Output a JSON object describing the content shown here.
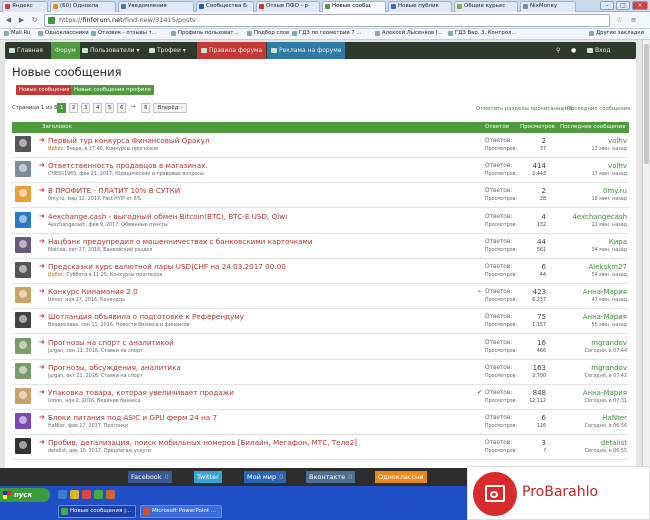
{
  "browser": {
    "tabs": [
      {
        "label": "Яндекс",
        "fav": "#d33"
      },
      {
        "label": "(60) Однокла",
        "fav": "#f08c1c"
      },
      {
        "label": "Уведомления",
        "fav": "#4a76a8"
      },
      {
        "label": "Сообщества Б",
        "fav": "#2a5ca8"
      },
      {
        "label": "Отзыв ПФО - р",
        "fav": "#c33"
      },
      {
        "label": "Новые сообщ",
        "fav": "#4f9a3f"
      },
      {
        "label": "Новые публик",
        "fav": "#3a6fb0"
      },
      {
        "label": "Общие курьес",
        "fav": "#8a4"
      },
      {
        "label": "NixMoney",
        "fav": "#888"
      }
    ],
    "url_scheme": "https://",
    "url_host": "finforum.net",
    "url_path": "/find-new/31415/posts",
    "bookmarks": [
      "Mail.Ru",
      "Одноклассники",
      "Отзовик - отзывы т...",
      "Профиль пользоват...",
      "Подбор слов",
      "ГДЗ по геометрии 7 ...",
      "Алексей Лысенков |...",
      "ГДЗ Вар. 3, Контрол..."
    ],
    "other_bookmarks": "Другие закладки"
  },
  "nav": {
    "items": [
      "Главная",
      "Форум",
      "Пользователи",
      "Трофеи",
      "Правила форума",
      "Реклама на форуме"
    ],
    "login": "Вход"
  },
  "page": {
    "title": "Новые сообщения",
    "tab_new": "Новые сообщения",
    "tab_profile": "Новые сообщения профиля",
    "pager_label": "Страница 1 из 8",
    "pages": [
      "1",
      "2",
      "3",
      "4",
      "5",
      "6",
      "→",
      "8"
    ],
    "next": "Вперёд ›",
    "mark_read": "Отметить разделы прочитанными",
    "latest_posts": "Последние сообщения"
  },
  "table": {
    "headers": {
      "title": "Заголовок",
      "replies": "Ответов",
      "views": "Просмотров",
      "last": "Последнее сообщение"
    },
    "replies_label": "Ответов:",
    "views_label": "Просмотров:",
    "rows": [
      {
        "title": "Первый тур конкурса Финансовый Оракул",
        "prefix": "Ирбис",
        "meta": ", Вчера, в 17:46, Конкурсы прогнозов",
        "replies": "2",
        "views": "37",
        "last_user": "volhv",
        "last_time": "13 мин. назад",
        "av": "#555"
      },
      {
        "title": "Ответственность продавцов в магазинах.",
        "prefix": "",
        "meta": "CHESS1965, фев 21, 2017, Юридические и правовые вопросы",
        "replies": "414",
        "views": "2,443",
        "last_user": "volhv",
        "last_time": "17 мин. назад",
        "av": "#7c8d9a"
      },
      {
        "title": "В ПРОФИТЕ - ПЛАТИТ 10% В СУТКИ",
        "prefix": "",
        "meta": "0my.ru, мар 12, 2017, Fast HYIP от 6%",
        "replies": "2",
        "views": "28",
        "last_user": "0my.ru",
        "last_time": "18 мин. назад",
        "av": "#e8a13a"
      },
      {
        "title": "4exchange.cash - выгодный обмен Bitcoin(BTC), BTC-E USD, Qiwi",
        "prefix": "",
        "meta": "4exchangecash, фев 9, 2017, Обменные пункты",
        "replies": "4",
        "views": "132",
        "last_user": "4exchangecash",
        "last_time": "22 мин. назад",
        "av": "#2b78c4"
      },
      {
        "title": "Нацбанк предупредил о мошенничествах с банковскими карточками",
        "prefix": "",
        "meta": "Matilda, окт 27, 2016, Банковский раздел",
        "replies": "44",
        "views": "561",
        "last_user": "Кира",
        "last_time": "34 мин. назад",
        "av": "#6a5a7a"
      },
      {
        "title": "Предсказки курс валютной пары USD|CHF на 24.03.2017 00:00",
        "prefix": "Ирбис",
        "meta": ", Суббота в 11:25, Конкурсы прогнозов",
        "replies": "6",
        "views": "44",
        "last_user": "Alekskm27",
        "last_time": "54 мин. назад",
        "av": "#555"
      },
      {
        "title": "Конкурс Кинамания 2.0",
        "prefix": "",
        "meta": "Umon, ноя 27, 2016, Конкурсы",
        "replies": "423",
        "views": "6,237",
        "last_user": "Анна-Мария",
        "last_time": "47 мин. назад",
        "av": "#c9a26a"
      },
      {
        "title": "Шотландия объявила о подготовке к Референдуму",
        "prefix": "",
        "meta": "Владислава, сен 11, 2016, Новости бизнеса и финансов",
        "replies": "75",
        "views": "1,157",
        "last_user": "Анна-Мария",
        "last_time": "55 мин. назад",
        "av": "#444"
      },
      {
        "title": "Прогнозы на спорт с аналитикой",
        "prefix": "",
        "meta": "jurgan, сен 11, 2016, Ставки на спорт",
        "replies": "16",
        "views": "466",
        "title_short": true,
        "last_user": "mgrandov",
        "last_time": "Сегодня, в 07:44",
        "av": "#7a9a6a"
      },
      {
        "title": "Прогнозы, обсуждения, аналитика",
        "prefix": "",
        "meta": "jurgan, окт 21, 2016, Ставки на спорт",
        "replies": "163",
        "views": "2,700",
        "last_user": "mgrandov",
        "last_time": "Сегодня, в 07:42",
        "av": "#7a9a6a"
      },
      {
        "title": "Упаковка товара, которая увеличивает продажи",
        "prefix": "",
        "meta": "Umon, ноя 2, 2016, Ведение бизнеса",
        "replies": "848",
        "views": "12,112",
        "last_user": "Анна-Мария",
        "last_time": "Сегодня, в 07:31",
        "av": "#c9a26a"
      },
      {
        "title": "Блоки питания под ASIC и GPU ферм 24 на 7",
        "prefix": "",
        "meta": "HaNter, фев 17, 2017, Прогонки",
        "replies": "6",
        "views": "116",
        "last_user": "HaNter",
        "last_time": "Сегодня, в 06:56",
        "av": "#7a4ab0"
      },
      {
        "title": "Пробив, детализация, поиск мобильных номеров [Билайн, Мегафон, МТС, Теле2]",
        "prefix": "",
        "meta": "detalist, дек 10, 2017, Предлагаю услуги",
        "replies": "3",
        "views": "?",
        "last_user": "detalist",
        "last_time": "Сегодня, в 06:55",
        "av": "#333"
      }
    ]
  },
  "social": {
    "facebook": "Facebook",
    "facebook_count": "0",
    "twitter": "Twitter",
    "mymir": "Мой мир",
    "mymir_count": "0",
    "vk": "Вконтакте",
    "vk_count": "0",
    "ok": "Одноклассни"
  },
  "taskbar": {
    "start": "пуск",
    "tasks": [
      "Новые сообщения |...",
      "Microsoft PowerPoint ..."
    ]
  },
  "watermark": "ProBarahlo"
}
